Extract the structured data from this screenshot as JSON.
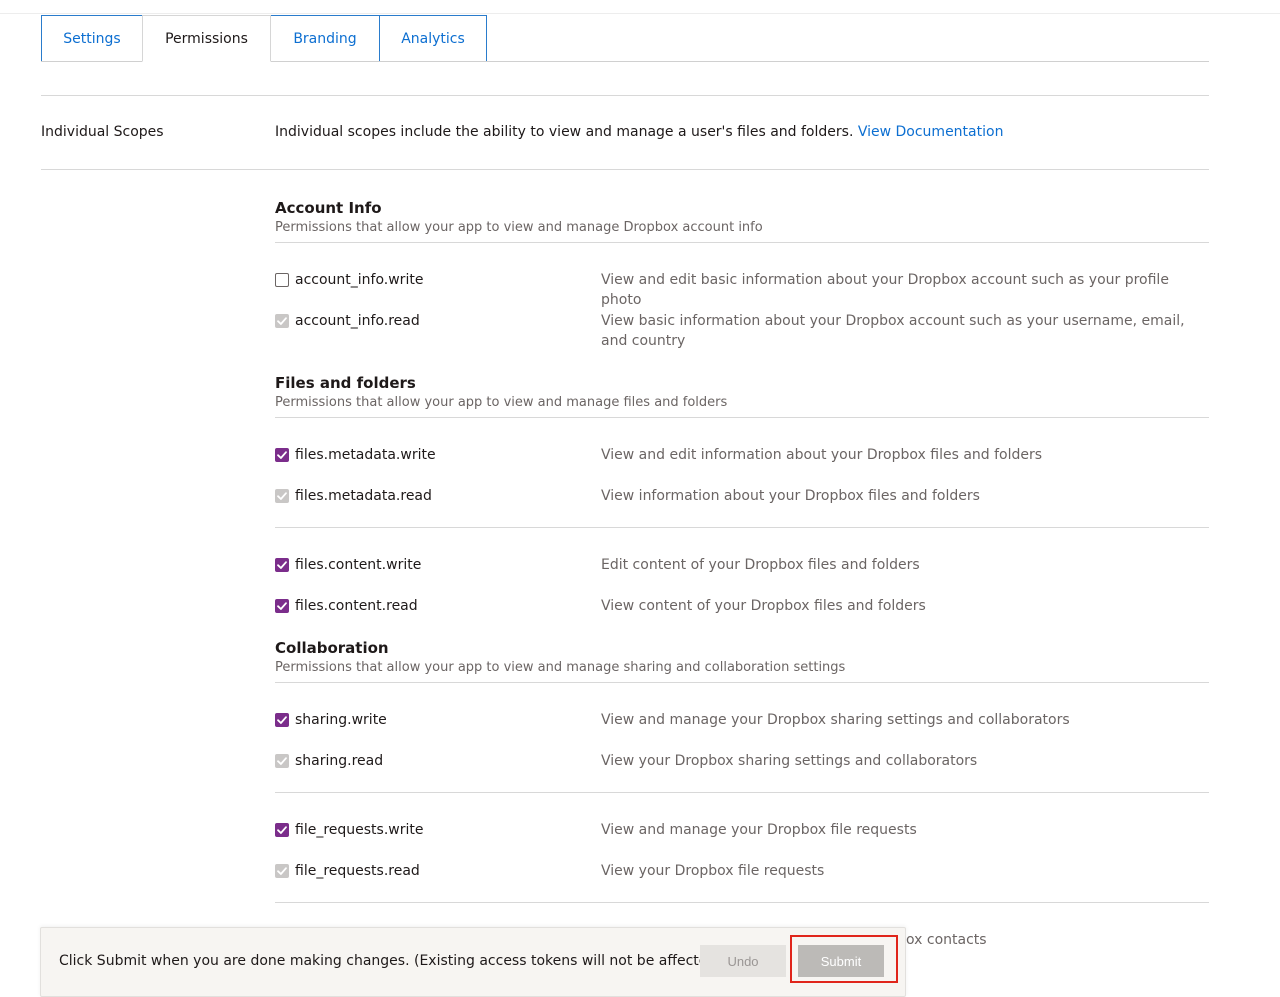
{
  "tabs": [
    {
      "label": "Settings",
      "active": false
    },
    {
      "label": "Permissions",
      "active": true
    },
    {
      "label": "Branding",
      "active": false
    },
    {
      "label": "Analytics",
      "active": false
    }
  ],
  "scopes": {
    "label": "Individual Scopes",
    "description": "Individual scopes include the ability to view and manage a user's files and folders.",
    "doc_link": "View Documentation"
  },
  "sections": [
    {
      "title": "Account Info",
      "subtitle": "Permissions that allow your app to view and manage Dropbox account info",
      "permissions": [
        {
          "name": "account_info.write",
          "state": "unchecked",
          "description": "View and edit basic information about your Dropbox account such as your profile photo"
        },
        {
          "name": "account_info.read",
          "state": "disabled",
          "description": "View basic information about your Dropbox account such as your username, email, and country"
        }
      ]
    },
    {
      "title": "Files and folders",
      "subtitle": "Permissions that allow your app to view and manage files and folders",
      "permissions": [
        {
          "name": "files.metadata.write",
          "state": "checked",
          "description": "View and edit information about your Dropbox files and folders"
        },
        {
          "name": "files.metadata.read",
          "state": "disabled",
          "description": "View information about your Dropbox files and folders"
        },
        {
          "name": "files.content.write",
          "state": "checked",
          "description": "Edit content of your Dropbox files and folders"
        },
        {
          "name": "files.content.read",
          "state": "checked",
          "description": "View content of your Dropbox files and folders"
        }
      ]
    },
    {
      "title": "Collaboration",
      "subtitle": "Permissions that allow your app to view and manage sharing and collaboration settings",
      "permissions": [
        {
          "name": "sharing.write",
          "state": "checked",
          "description": "View and manage your Dropbox sharing settings and collaborators"
        },
        {
          "name": "sharing.read",
          "state": "disabled",
          "description": "View your Dropbox sharing settings and collaborators"
        },
        {
          "name": "file_requests.write",
          "state": "checked",
          "description": "View and manage your Dropbox file requests"
        },
        {
          "name": "file_requests.read",
          "state": "disabled",
          "description": "View your Dropbox file requests"
        }
      ]
    }
  ],
  "partial_text": "ox contacts",
  "bottom_bar": {
    "message": "Click Submit when you are done making changes. (Existing access tokens will not be affected)",
    "undo_label": "Undo",
    "submit_label": "Submit"
  },
  "colors": {
    "link": "#0d6fd1",
    "checkbox_checked": "#7b2d8b",
    "checkbox_disabled": "#c9c7c6",
    "highlight": "#e0251b"
  }
}
